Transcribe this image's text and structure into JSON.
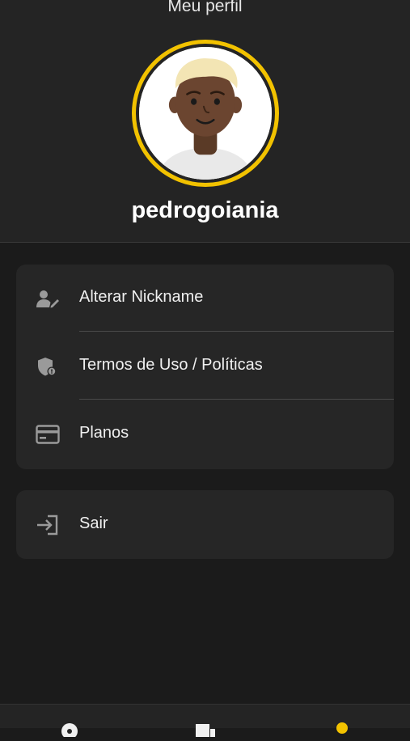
{
  "header": {
    "title": "Meu perfil",
    "username": "pedrogoiania",
    "avatar_ring_color": "#f2c200"
  },
  "menu": {
    "items": [
      {
        "label": "Alterar Nickname",
        "icon": "user-edit-icon"
      },
      {
        "label": "Termos de Uso / Políticas",
        "icon": "shield-icon"
      },
      {
        "label": "Planos",
        "icon": "credit-card-icon"
      }
    ],
    "logout": {
      "label": "Sair",
      "icon": "logout-icon"
    }
  },
  "bottom_nav": {
    "items": [
      {
        "icon": "home-icon"
      },
      {
        "icon": "book-icon"
      },
      {
        "icon": "profile-icon",
        "active": true
      }
    ],
    "active_color": "#f2c200"
  }
}
